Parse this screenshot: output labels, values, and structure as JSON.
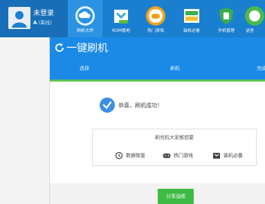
{
  "user": {
    "name": "未登录",
    "status_mark": "A",
    "status": "(离线)"
  },
  "nav": [
    {
      "label": "刷机大师",
      "icon": "cloud-icon",
      "active": true
    },
    {
      "label": "ROM基地",
      "icon": "rom-box-icon",
      "active": false
    },
    {
      "label": "热门游戏",
      "icon": "game-controller-icon",
      "active": false
    },
    {
      "label": "装机必备",
      "icon": "app-window-icon",
      "active": false
    },
    {
      "label": "手机管理",
      "icon": "shield-icon",
      "active": false
    },
    {
      "label": "语音",
      "icon": "speaker-icon",
      "active": false
    }
  ],
  "main": {
    "title": "一键刷机",
    "steps": [
      "选择",
      "刷机",
      "完成"
    ],
    "success_message": "恭喜，刷机成功！"
  },
  "card": {
    "title": "刷完机大家都想要",
    "links": [
      {
        "label": "数据恢复",
        "icon": "restore-icon"
      },
      {
        "label": "热门游戏",
        "icon": "gamepad-icon"
      },
      {
        "label": "装机必备",
        "icon": "package-icon"
      }
    ]
  },
  "footer": {
    "share_label": "分享战绩"
  },
  "colors": {
    "topbar": "#1b7fd0",
    "accent": "#1a8ae6",
    "progress": "#5dc552",
    "share_button": "#3dbb43"
  }
}
